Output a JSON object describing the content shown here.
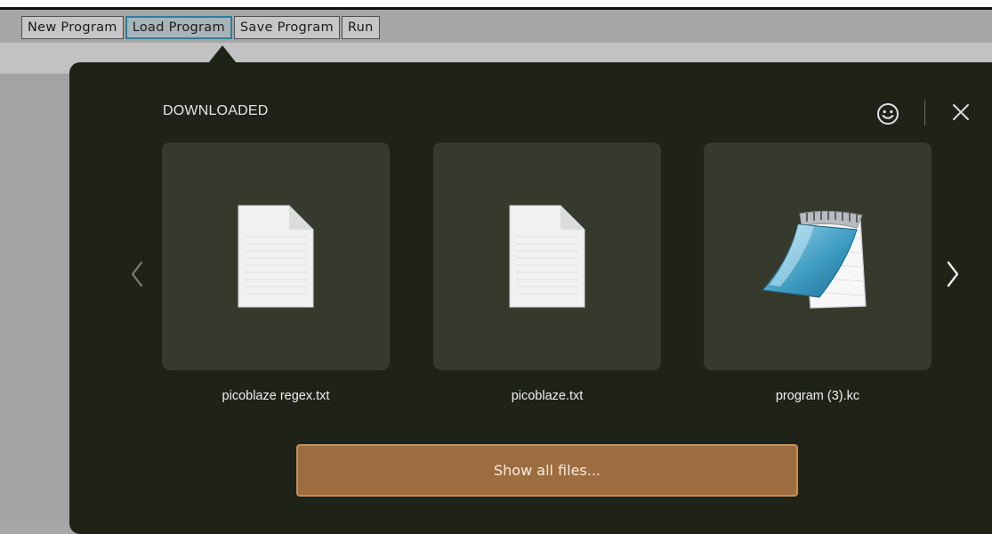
{
  "toolbar": {
    "buttons": [
      {
        "label": "New Program",
        "active": false
      },
      {
        "label": "Load Program",
        "active": true
      },
      {
        "label": "Save Program",
        "active": false
      },
      {
        "label": "Run",
        "active": false
      }
    ]
  },
  "downloads": {
    "heading": "DOWNLOADED",
    "feedback_icon": "smiley-icon",
    "close_icon": "close-icon",
    "prev_icon": "chevron-left-icon",
    "next_icon": "chevron-right-icon",
    "files": [
      {
        "name": "picoblaze regex.txt",
        "icon": "text-file-icon"
      },
      {
        "name": "picoblaze.txt",
        "icon": "text-file-icon"
      },
      {
        "name": "program (3).kc",
        "icon": "notepad-icon"
      }
    ],
    "show_all_label": "Show all files..."
  },
  "colors": {
    "panel_bg": "#1f2217",
    "card_bg": "#363a2c",
    "button_bg": "#9d6d3f",
    "active_tab_border": "#2f7e9e"
  }
}
